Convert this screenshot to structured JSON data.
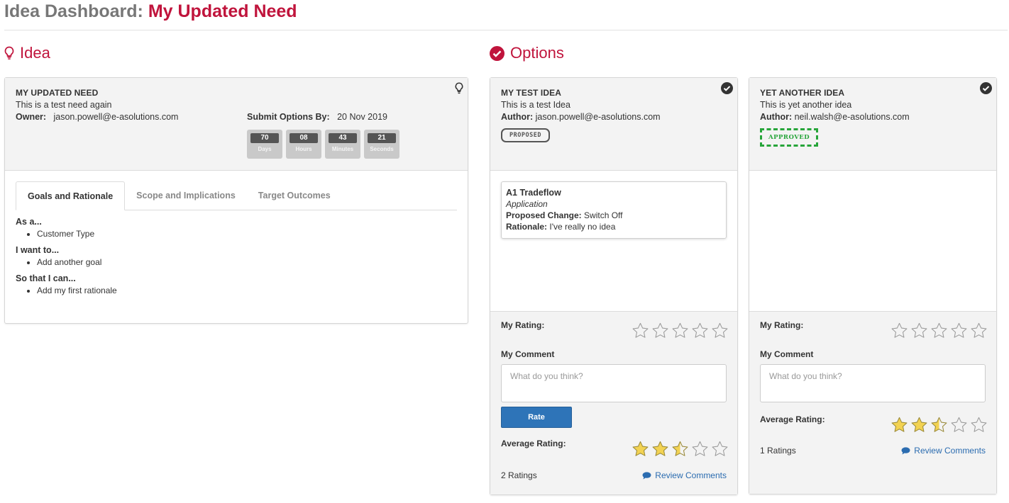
{
  "header": {
    "prefix": "Idea Dashboard:",
    "title": "My Updated Need"
  },
  "idea_section": {
    "title": "Idea"
  },
  "options_section": {
    "title": "Options"
  },
  "idea": {
    "name": "MY UPDATED NEED",
    "description": "This is a test need again",
    "owner_label": "Owner:",
    "owner": "jason.powell@e-asolutions.com",
    "submit_label": "Submit Options By:",
    "submit_date": "20 Nov 2019",
    "countdown": [
      {
        "value": "70",
        "unit": "Days"
      },
      {
        "value": "08",
        "unit": "Hours"
      },
      {
        "value": "43",
        "unit": "Minutes"
      },
      {
        "value": "21",
        "unit": "Seconds"
      }
    ],
    "tabs": [
      "Goals and Rationale",
      "Scope and Implications",
      "Target Outcomes"
    ],
    "goals": {
      "as_a_label": "As a...",
      "as_a": "Customer Type",
      "want_label": "I want to...",
      "want": "Add another goal",
      "so_label": "So that I can...",
      "so": "Add my first rationale"
    }
  },
  "options": [
    {
      "name": "MY TEST IDEA",
      "description": "This is a test Idea",
      "author_label": "Author:",
      "author": "jason.powell@e-asolutions.com",
      "status": "PROPOSED",
      "change": {
        "title": "A1 Tradeflow",
        "type": "Application",
        "change_label": "Proposed Change:",
        "change": "Switch Off",
        "rationale_label": "Rationale:",
        "rationale": "I've really no idea"
      },
      "my_rating_label": "My Rating:",
      "my_rating": 0,
      "comment_label": "My Comment",
      "comment_placeholder": "What do you think?",
      "rate_button": "Rate",
      "avg_label": "Average Rating:",
      "avg_rating": 2.5,
      "ratings_count": "2 Ratings",
      "review_link": "Review Comments"
    },
    {
      "name": "YET ANOTHER IDEA",
      "description": "This is yet another idea",
      "author_label": "Author:",
      "author": "neil.walsh@e-asolutions.com",
      "status": "APPROVED",
      "my_rating_label": "My Rating:",
      "my_rating": 0,
      "comment_label": "My Comment",
      "comment_placeholder": "What do you think?",
      "avg_label": "Average Rating:",
      "avg_rating": 2.5,
      "ratings_count": "1 Ratings",
      "review_link": "Review Comments"
    }
  ],
  "colors": {
    "accent": "#c0143c",
    "link": "#2b6cb0",
    "star_fill": "#f2d252",
    "approved": "#27a53a"
  },
  "icons": {
    "idea": "lightbulb-icon",
    "options": "check-circle-icon",
    "review": "comment-bubble-icon",
    "star": "star-icon"
  }
}
